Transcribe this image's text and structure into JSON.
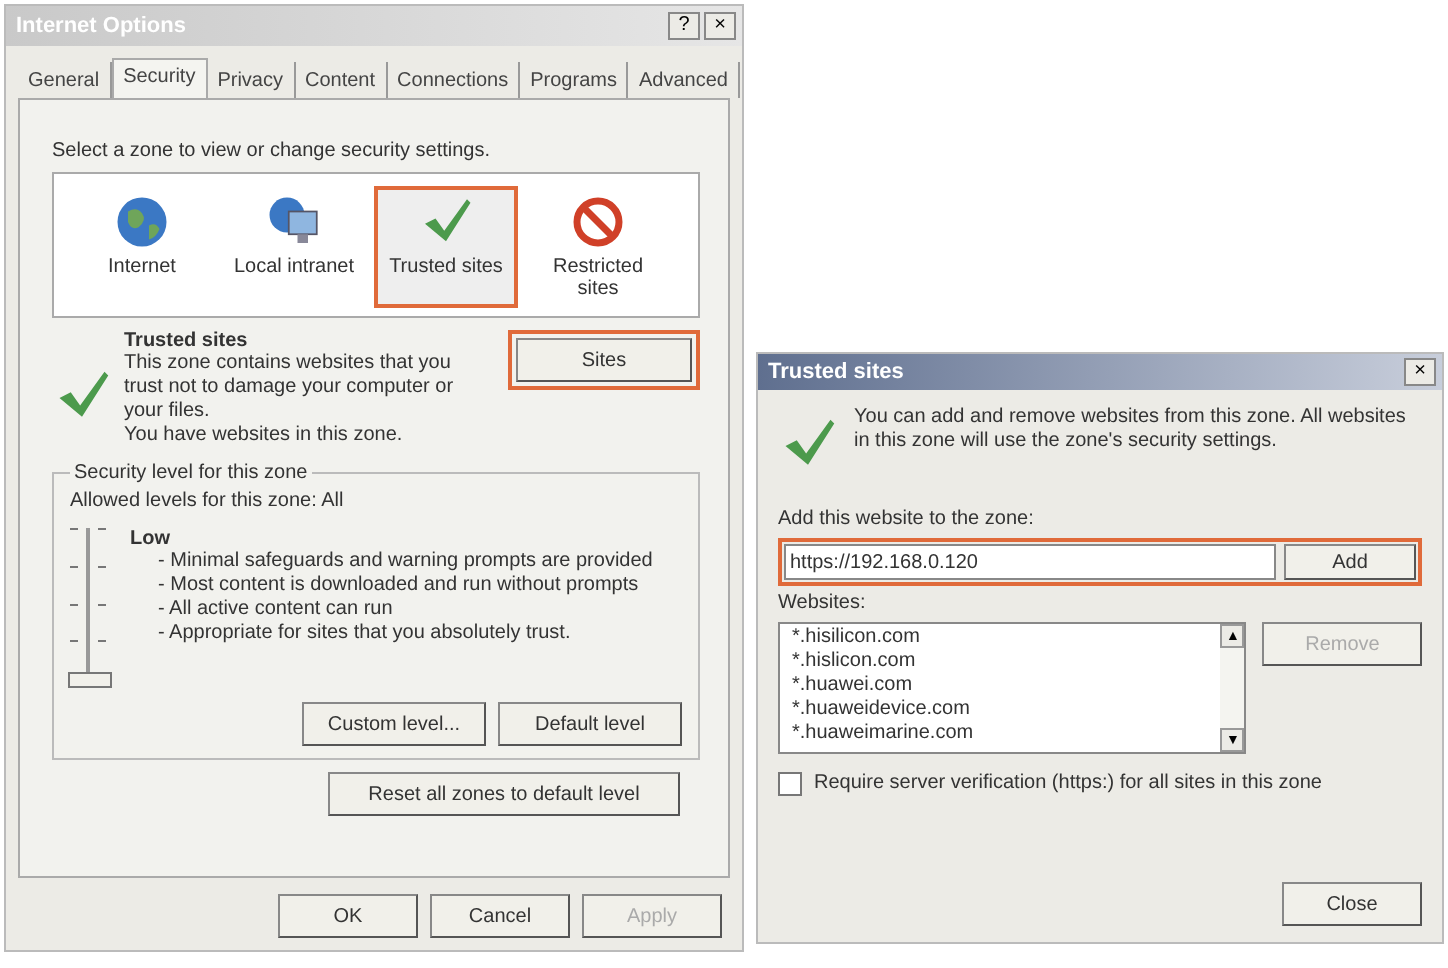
{
  "internet_options": {
    "window": {
      "title": "Internet Options",
      "help": "?",
      "close": "×"
    },
    "tabs": [
      {
        "label": "General",
        "selected": false
      },
      {
        "label": "Security",
        "selected": true
      },
      {
        "label": "Privacy",
        "selected": false
      },
      {
        "label": "Content",
        "selected": false
      },
      {
        "label": "Connections",
        "selected": false
      },
      {
        "label": "Programs",
        "selected": false
      },
      {
        "label": "Advanced",
        "selected": false
      }
    ],
    "zone_prompt": "Select a zone to view or change security settings.",
    "zones": [
      {
        "kind": "globe",
        "label": "Internet",
        "selected": false,
        "highlighted": false
      },
      {
        "kind": "network",
        "label": "Local intranet",
        "selected": false,
        "highlighted": false
      },
      {
        "kind": "check",
        "label": "Trusted sites",
        "selected": true,
        "highlighted": true
      },
      {
        "kind": "blocked",
        "label": "Restricted sites",
        "selected": false,
        "highlighted": false
      }
    ],
    "zone_info": {
      "title": "Trusted sites",
      "description": "This zone contains websites that you trust not to damage your computer or your files.",
      "note": "You have websites in this zone."
    },
    "sites_button": {
      "label": "Sites",
      "highlighted": true
    },
    "security_level": {
      "legend": "Security level for this zone",
      "allowed": "Allowed levels for this zone: All",
      "level": 0,
      "name": "Low",
      "details": [
        "- Minimal safeguards and warning prompts are provided",
        "- Most content is downloaded and run without prompts",
        "- All active content can run",
        "- Appropriate for sites that you absolutely trust."
      ],
      "buttons": [
        {
          "label": "Custom level...",
          "disabled": false
        },
        {
          "label": "Default level",
          "disabled": false
        }
      ]
    },
    "reset_button": {
      "label": "Reset all zones to default level",
      "disabled": false
    },
    "footer_buttons": [
      {
        "label": "OK",
        "disabled": false
      },
      {
        "label": "Cancel",
        "disabled": false
      },
      {
        "label": "Apply",
        "disabled": true
      }
    ]
  },
  "trusted_sites": {
    "window": {
      "title": "Trusted sites",
      "close": "×"
    },
    "message": "You can add and remove websites from this zone. All websites in this zone will use the zone's security settings.",
    "add_label": "Add this website to the zone:",
    "add_field": {
      "value": "https://192.168.0.120",
      "highlighted": true
    },
    "add_button": {
      "label": "Add",
      "disabled": false
    },
    "websites_label": "Websites:",
    "websites": [
      "*.hisilicon.com",
      "*.hislicon.com",
      "*.huawei.com",
      "*.huaweidevice.com",
      "*.huaweimarine.com"
    ],
    "remove_button": {
      "label": "Remove",
      "disabled": true
    },
    "scroll_up": "▲",
    "scroll_down": "▼",
    "require_https": {
      "label": "Require server verification (https:) for all sites in this zone",
      "checked": false
    },
    "close_button": {
      "label": "Close",
      "disabled": false
    }
  }
}
